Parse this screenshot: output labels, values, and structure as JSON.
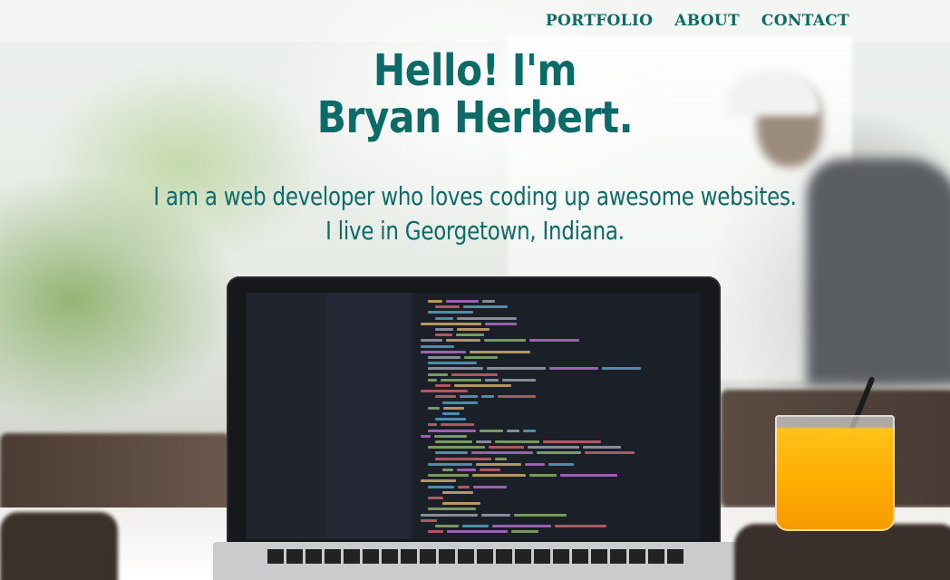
{
  "nav": {
    "items": [
      {
        "label": "PORTFOLIO"
      },
      {
        "label": "ABOUT"
      },
      {
        "label": "CONTACT"
      }
    ]
  },
  "hero": {
    "title_line1": "Hello! I'm",
    "title_line2": "Bryan Herbert.",
    "sub_line1": "I am a web developer who loves coding up awesome websites.",
    "sub_line2": "I live in Georgetown, Indiana."
  },
  "colors": {
    "accent": "#0c6b67"
  }
}
